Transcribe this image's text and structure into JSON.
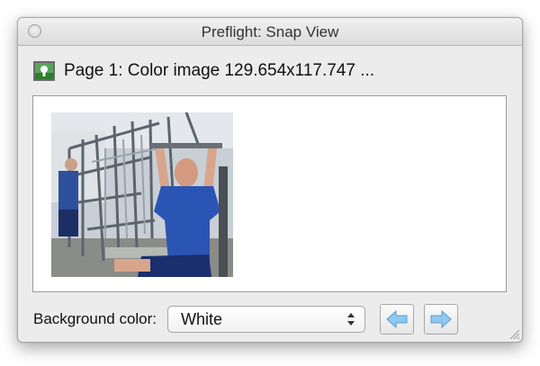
{
  "window": {
    "title": "Preflight: Snap View"
  },
  "info": {
    "icon": "image-icon",
    "text": "Page 1: Color image 129.654x117.747 ..."
  },
  "preview": {
    "background": "#ffffff",
    "image_icon": "photo-thumbnail"
  },
  "background_control": {
    "label": "Background color:",
    "selected_value": "White"
  },
  "navigation": {
    "prev_icon": "left-arrow-icon",
    "next_icon": "right-arrow-icon",
    "arrow_color": "#8fc8f0"
  }
}
